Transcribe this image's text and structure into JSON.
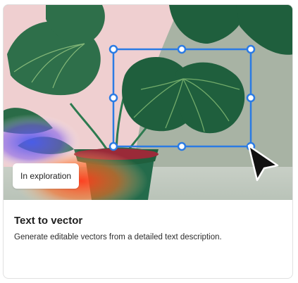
{
  "card": {
    "badge_label": "In exploration",
    "title": "Text to vector",
    "description": "Generate editable vectors from a detailed text description."
  },
  "colors": {
    "selection_blue": "#2b7be4",
    "background_pink": "#efcfd0",
    "background_sage": "#a8b3a4",
    "leaf_green": "#1f5f3d",
    "pot_green": "#246b4b"
  },
  "icons": {
    "cursor": "arrow-cursor-icon"
  }
}
